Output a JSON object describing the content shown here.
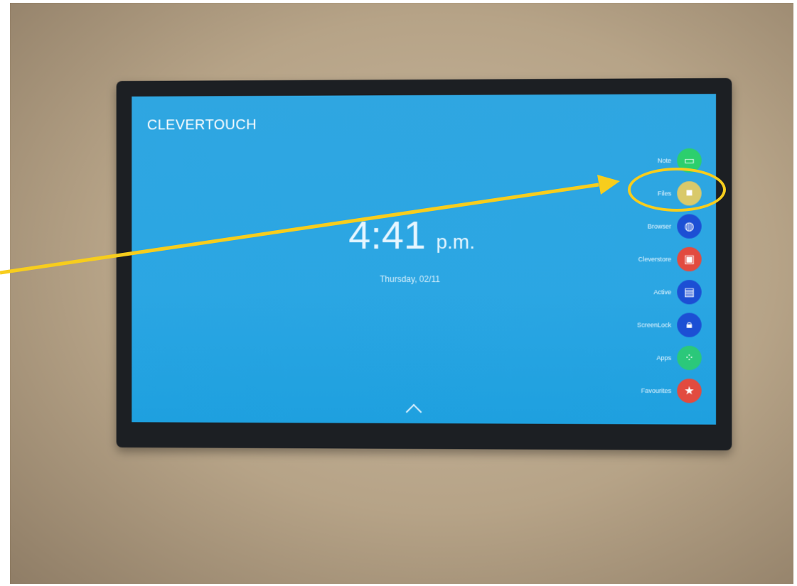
{
  "brand": "CLEVERTOUCH",
  "clock": {
    "time": "4:41",
    "ampm": "p.m.",
    "date": "Thursday, 02/11"
  },
  "dock": {
    "items": [
      {
        "label": "Note",
        "icon": "note-icon",
        "color": "#2ccf6d"
      },
      {
        "label": "Files",
        "icon": "folder-icon",
        "color": "#d9c96a"
      },
      {
        "label": "Browser",
        "icon": "globe-icon",
        "color": "#1c4fd4"
      },
      {
        "label": "Cleverstore",
        "icon": "bag-icon",
        "color": "#e24b3f"
      },
      {
        "label": "Active",
        "icon": "windows-icon",
        "color": "#1c4fd4"
      },
      {
        "label": "ScreenLock",
        "icon": "lock-icon",
        "color": "#1c4fd4"
      },
      {
        "label": "Apps",
        "icon": "grid-icon",
        "color": "#2bc87a"
      },
      {
        "label": "Favourites",
        "icon": "star-icon",
        "color": "#e24b3f"
      }
    ]
  },
  "annotation": {
    "color": "#f7cd1d"
  }
}
